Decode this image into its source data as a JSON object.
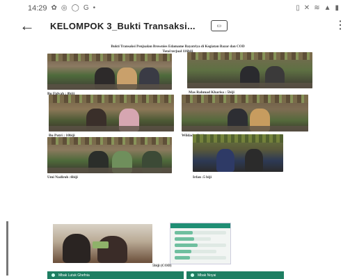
{
  "status_bar": {
    "time": "14:29",
    "left_icons": [
      "settings-icon",
      "instagram-icon",
      "whatsapp-icon",
      "google-icon",
      "dot-icon"
    ],
    "right_icons": [
      "vibrate-icon",
      "mute-icon",
      "wifi-icon",
      "signal-icon",
      "battery-icon"
    ]
  },
  "app_bar": {
    "title": "KELOMPOK 3_Bukti Transaksi...",
    "reading_mode_icon": "reading-mode-icon",
    "menu_icon": "more-vert-icon"
  },
  "document": {
    "title_line1": "Bukti Transaksi Penjualan Brownies Edamame Bayatriya di Kegiatan Bazar dan COD",
    "title_line2": "Total terjual 116biji",
    "captions": [
      "Bu Fidyah : 8biji",
      "Mas Rahmad Kharisa : 5biji",
      "Bu Putri : 10biji",
      "Wildad : 3biji",
      "Umi Nadiroh :6biji",
      "Irfan :5 biji"
    ]
  },
  "page2": {
    "caption": "5biji (COD)",
    "chat_header_1": "Mbak Lutuk Ghefnia",
    "chat_header_2": "Mbak Noyai"
  }
}
